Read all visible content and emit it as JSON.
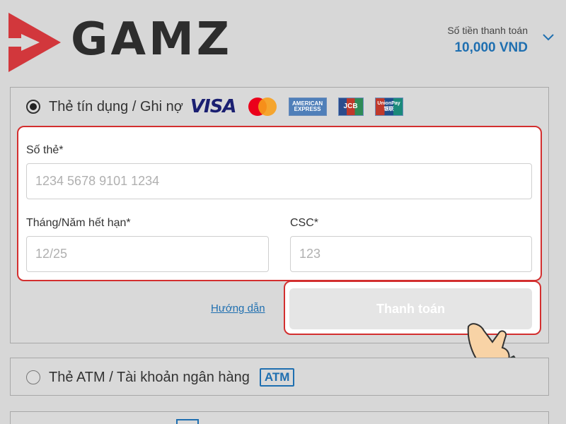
{
  "header": {
    "logo_text": "GAMZ",
    "amount_label": "Số tiền thanh toán",
    "amount_value": "10,000 VND"
  },
  "methods": {
    "card": {
      "label": "Thẻ tín dụng / Ghi nợ",
      "brands": {
        "visa": "VISA",
        "amex": "AMERICAN EXPRESS",
        "jcb": "JCB",
        "unionpay": "UnionPay 银联"
      }
    },
    "atm": {
      "label": "Thẻ ATM / Tài khoản ngân hàng",
      "badge": "ATM"
    }
  },
  "form": {
    "card_number_label": "Số thẻ*",
    "card_number_placeholder": "1234 5678 9101 1234",
    "expiry_label": "Tháng/Năm hết hạn*",
    "expiry_placeholder": "12/25",
    "csc_label": "CSC*",
    "csc_placeholder": "123",
    "help_link": "Hướng dẫn",
    "pay_button": "Thanh toán"
  },
  "colors": {
    "brand_red": "#d2373c",
    "accent_blue": "#1f6fb0",
    "highlight_red": "#d32f2f"
  }
}
